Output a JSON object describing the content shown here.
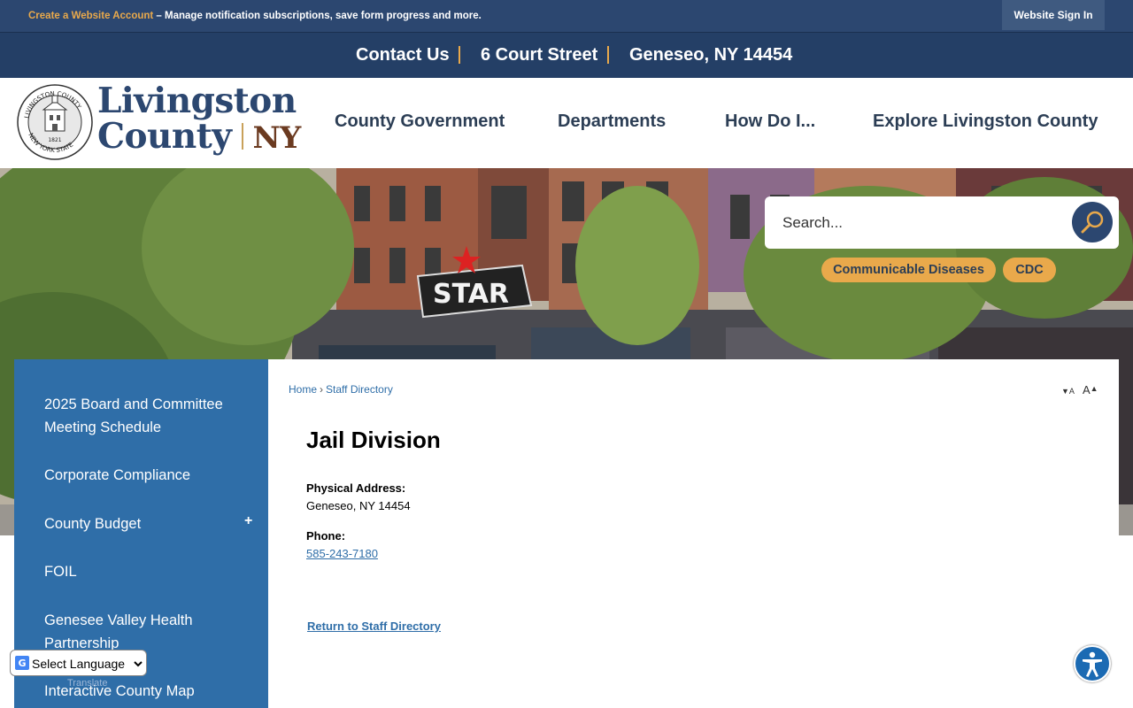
{
  "account_bar": {
    "create_link": "Create a Website Account",
    "message": " – Manage notification subscriptions, save form progress and more.",
    "signin_label": "Website Sign In"
  },
  "contact_bar": {
    "contact": "Contact Us",
    "address": "6 Court Street",
    "city": "Geneseo, NY 14454"
  },
  "logo": {
    "line1": "Livingston",
    "line2": "County",
    "suffix": "NY",
    "seal_top_text": "LIVINGSTON COUNTY",
    "seal_bottom_text": "NEW YORK STATE",
    "seal_year": "1821"
  },
  "nav": {
    "items": [
      "County Government",
      "Departments",
      "How Do I...",
      "Explore Livingston County"
    ]
  },
  "search": {
    "placeholder": "Search..."
  },
  "quick_links": [
    "Communicable Diseases",
    "CDC"
  ],
  "sidebar": {
    "items": [
      "2025 Board and Committee Meeting Schedule",
      "Corporate Compliance",
      "County Budget",
      "FOIL",
      "Genesee Valley Health Partnership",
      "Interactive County Map"
    ],
    "expand_symbol": "+"
  },
  "breadcrumb": {
    "home": "Home",
    "separator": "›",
    "current": "Staff Directory"
  },
  "font_controls": {
    "decrease": "A",
    "increase": "A"
  },
  "content": {
    "title": "Jail Division",
    "address_label": "Physical Address:",
    "address_value": "Geneseo, NY 14454",
    "phone_label": "Phone:",
    "phone_value": "585-243-7180",
    "return_link": "Return to Staff Directory"
  },
  "translate": {
    "select_label": "Select Language",
    "powered": "Translate"
  },
  "colors": {
    "navy": "#2c4770",
    "gold": "#e9a94b",
    "sidebar_blue": "#2f6ea8"
  }
}
